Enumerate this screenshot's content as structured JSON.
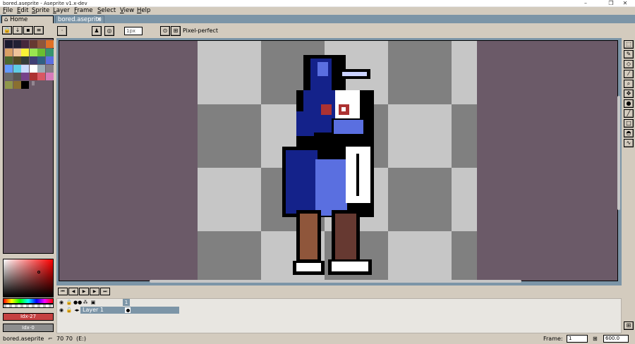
{
  "window": {
    "title": "bored.aseprite - Aseprite v1.x-dev",
    "minimize": "–",
    "maximize": "❐",
    "close": "✕"
  },
  "menu": [
    "File",
    "Edit",
    "Sprite",
    "Layer",
    "Frame",
    "Select",
    "View",
    "Help"
  ],
  "tabs": {
    "home": "Home",
    "file": "bored.aseprite",
    "close": "✕"
  },
  "context": {
    "brush_size": "1px",
    "pixel_perfect": "Pixel-perfect"
  },
  "palette": {
    "colors": [
      "#1a1a2e",
      "#222034",
      "#45283c",
      "#663931",
      "#8f563b",
      "#df7126",
      "#d9a066",
      "#eec39a",
      "#fbf236",
      "#99e550",
      "#6abe30",
      "#37946e",
      "#4b692f",
      "#524b24",
      "#323c39",
      "#3f3f74",
      "#306082",
      "#5b6ee1",
      "#639bff",
      "#5fcde4",
      "#cbdbfc",
      "#ffffff",
      "#9badb7",
      "#847e87",
      "#696a6a",
      "#595652",
      "#76428a",
      "#ac3232",
      "#d95763",
      "#d77bba",
      "#8f974a",
      "#8a6f30",
      "#000000"
    ],
    "index_label": "||"
  },
  "color_bar": {
    "fg_label": "Idx-27",
    "bg_label": "Idx-0"
  },
  "canvas": {
    "bg_color": "#6b5a68",
    "checker_light": "#c6c6c6",
    "checker_dark": "#808080"
  },
  "timeline": {
    "playback": [
      "⏮",
      "◀",
      "▶",
      "▶",
      "⏭"
    ],
    "layer_name": "Layer 1",
    "frame_number": "1"
  },
  "status": {
    "file": "bored.aseprite",
    "coords": "70 70",
    "extra": "(E:)",
    "frame_label": "Frame:",
    "frame_value": "1",
    "zoom_value": "600.0"
  }
}
